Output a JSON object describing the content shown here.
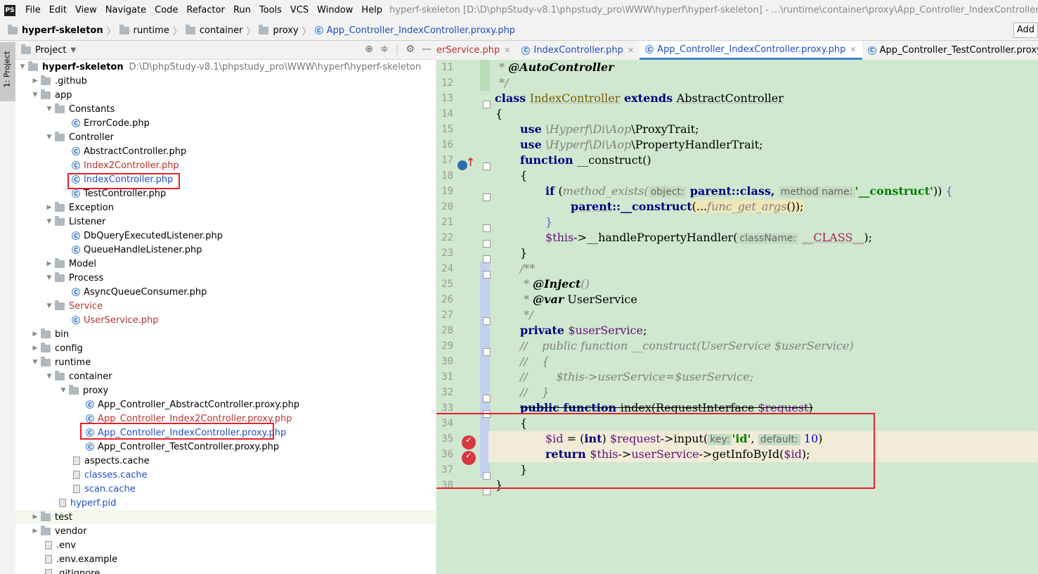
{
  "window": {
    "logo": "PS",
    "menu": [
      "File",
      "Edit",
      "View",
      "Navigate",
      "Code",
      "Refactor",
      "Run",
      "Tools",
      "VCS",
      "Window",
      "Help"
    ],
    "title": "hyperf-skeleton [D:\\D\\phpStudy-v8.1\\phpstudy_pro\\WWW\\hyperf\\hyperf-skeleton] - ...\\runtime\\container\\proxy\\App_Controller_IndexController.proxy.php - PhpStorm"
  },
  "breadcrumb": {
    "items": [
      "hyperf-skeleton",
      "runtime",
      "container",
      "proxy",
      "App_Controller_IndexController.proxy.php"
    ],
    "add_label": "Add"
  },
  "side_strip": {
    "project_tab": "1: Project"
  },
  "project": {
    "header": "Project",
    "root": {
      "name": "hyperf-skeleton",
      "path": "D:\\D\\phpStudy-v8.1\\phpstudy_pro\\WWW\\hyperf\\hyperf-skeleton"
    },
    "items": [
      {
        "label": ".github"
      },
      {
        "label": "app"
      },
      {
        "label": "Constants"
      },
      {
        "label": "ErrorCode.php"
      },
      {
        "label": "Controller"
      },
      {
        "label": "AbstractController.php"
      },
      {
        "label": "Index2Controller.php"
      },
      {
        "label": "IndexController.php"
      },
      {
        "label": "TestController.php"
      },
      {
        "label": "Exception"
      },
      {
        "label": "Listener"
      },
      {
        "label": "DbQueryExecutedListener.php"
      },
      {
        "label": "QueueHandleListener.php"
      },
      {
        "label": "Model"
      },
      {
        "label": "Process"
      },
      {
        "label": "AsyncQueueConsumer.php"
      },
      {
        "label": "Service"
      },
      {
        "label": "UserService.php"
      },
      {
        "label": "bin"
      },
      {
        "label": "config"
      },
      {
        "label": "runtime"
      },
      {
        "label": "container"
      },
      {
        "label": "proxy"
      },
      {
        "label": "App_Controller_AbstractController.proxy.php"
      },
      {
        "label": "App_Controller_Index2Controller.proxy.php"
      },
      {
        "label": "App_Controller_IndexController.proxy.php"
      },
      {
        "label": "App_Controller_TestController.proxy.php"
      },
      {
        "label": "aspects.cache"
      },
      {
        "label": "classes.cache"
      },
      {
        "label": "scan.cache"
      },
      {
        "label": "hyperf.pid"
      },
      {
        "label": "test"
      },
      {
        "label": "vendor"
      },
      {
        "label": ".env"
      },
      {
        "label": ".env.example"
      },
      {
        "label": ".gitignore"
      }
    ]
  },
  "tabs": [
    "erService.php",
    "IndexController.php",
    "App_Controller_IndexController.proxy.php",
    "App_Controller_TestController.proxy.php"
  ],
  "editor": {
    "line_numbers": [
      "11",
      "12",
      "13",
      "14",
      "15",
      "16",
      "17",
      "18",
      "19",
      "20",
      "21",
      "22",
      "23",
      "24",
      "25",
      "26",
      "27",
      "28",
      "29",
      "30",
      "31",
      "32",
      "33",
      "34",
      "35",
      "36",
      "37",
      "38"
    ],
    "code": {
      "l11": {
        "a": " * ",
        "b": "@AutoController"
      },
      "l12": {
        "a": " */"
      },
      "l13": {
        "a": "class ",
        "b": "IndexController",
        "c": " extends ",
        "d": "AbstractController"
      },
      "l14": {
        "a": "{"
      },
      "l15": {
        "a": "use ",
        "b": "\\Hyperf\\Di\\Aop",
        "c": "\\ProxyTrait;"
      },
      "l16": {
        "a": "use ",
        "b": "\\Hyperf\\Di\\Aop",
        "c": "\\PropertyHandlerTrait;"
      },
      "l17": {
        "a": "function ",
        "b": "__construct()"
      },
      "l18": {
        "a": "{"
      },
      "l19": {
        "a": "if ",
        "b": "(",
        "c": "method_exists(",
        "d": "object:",
        "e": "parent",
        "f": "::class,",
        "g": "method name:",
        "h": "'__construct'",
        "i": "))",
        "j": "{"
      },
      "l20": {
        "a": "parent",
        "b": "::__construct",
        "c": "(...",
        "d": "func_get_args",
        "e": "());"
      },
      "l21": {
        "a": "}"
      },
      "l22": {
        "a": "$this",
        "b": "->__handlePropertyHandler(",
        "c": "className:",
        "d": "__CLASS__",
        "e": ");"
      },
      "l23": {
        "a": "}"
      },
      "l24": {
        "a": "/**"
      },
      "l25": {
        "a": " * ",
        "b": "@Inject",
        "c": "()"
      },
      "l26": {
        "a": " * ",
        "b": "@var",
        "c": " UserService"
      },
      "l27": {
        "a": " */"
      },
      "l28": {
        "a": "private ",
        "b": "$userService",
        "c": ";"
      },
      "l29": {
        "a": "//    public function __construct(UserService $userService)"
      },
      "l30": {
        "a": "//    {"
      },
      "l31": {
        "a": "//        $this->userService=$userService;"
      },
      "l32": {
        "a": "//    }"
      },
      "l33": {
        "a": "public function ",
        "b": "index(RequestInterface ",
        "c": "$request",
        "d": ")"
      },
      "l34": {
        "a": "{"
      },
      "l35": {
        "a": "$id",
        "b": " = (",
        "c": "int",
        "d": ") ",
        "e": "$request",
        "f": "->input(",
        "g": "key:",
        "h": "'id'",
        "i": ",",
        "j": "default:",
        "k": "10",
        "l": ")"
      },
      "l36": {
        "a": "return ",
        "b": "$this",
        "c": "->",
        "d": "userService",
        "e": "->getInfoById(",
        "f": "$id",
        "g": ");"
      },
      "l37": {
        "a": "}"
      },
      "l38": {
        "a": "}"
      }
    }
  },
  "colors": {
    "editor_bg": "#cfe8cf",
    "highlight_box": "#e8202a",
    "active_tab": "#4083c9",
    "breakpoint": "#d7373f"
  }
}
